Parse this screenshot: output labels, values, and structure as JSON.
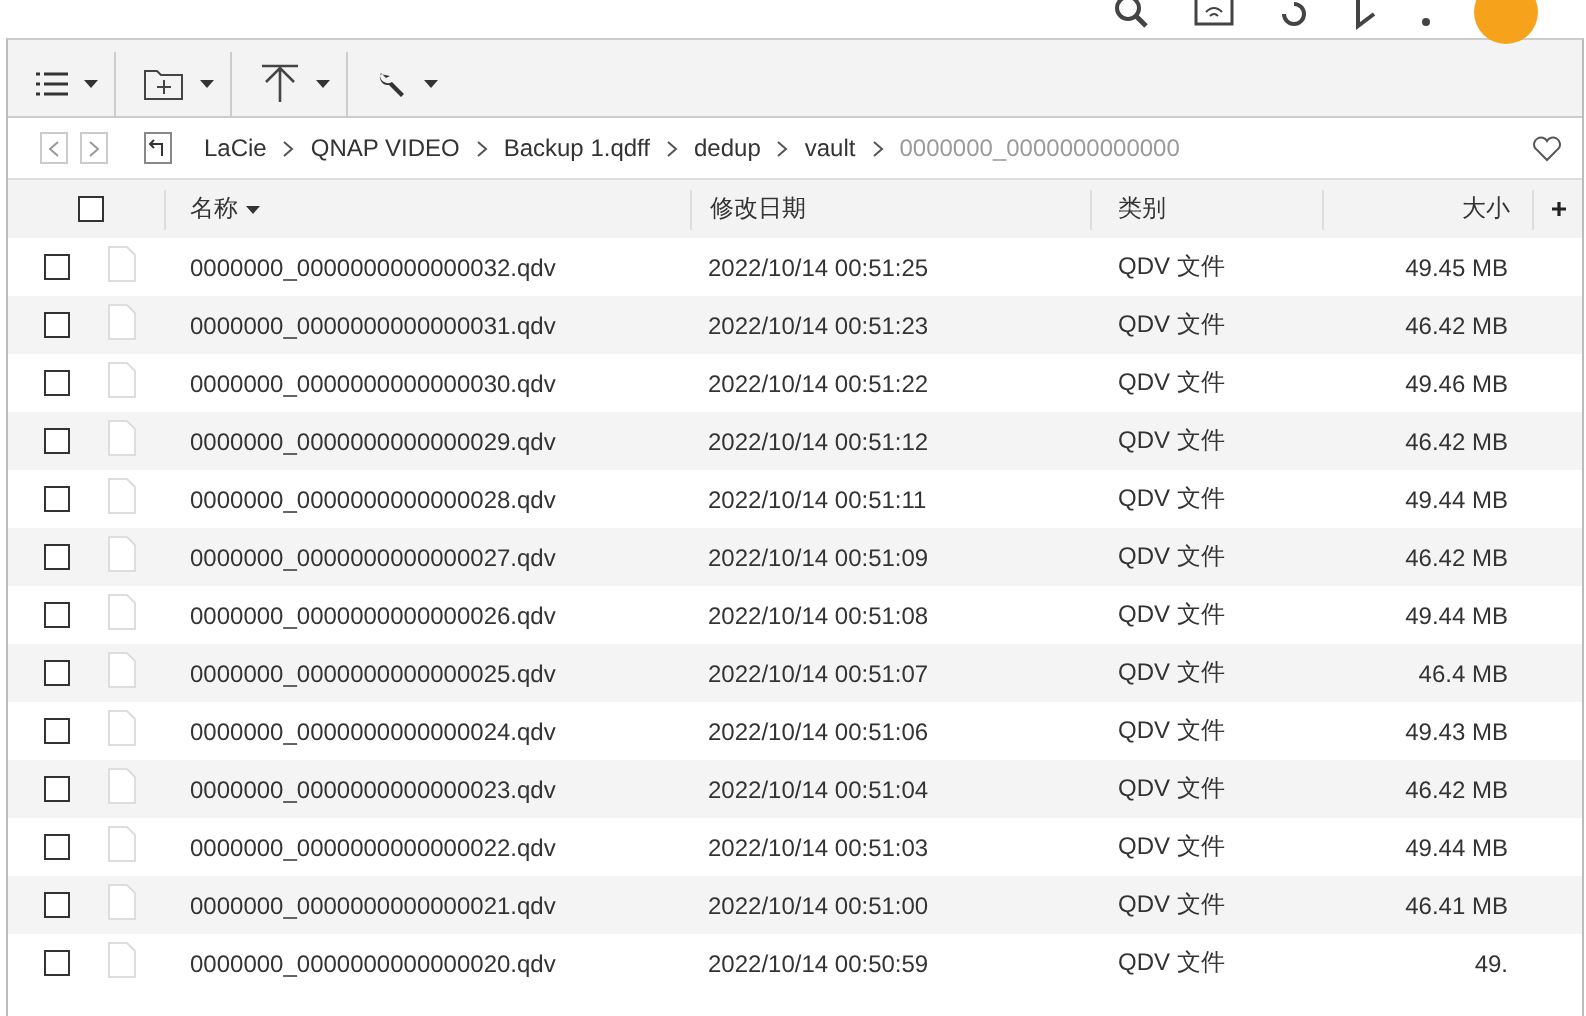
{
  "breadcrumb": [
    {
      "label": "LaCie",
      "current": false
    },
    {
      "label": "QNAP VIDEO",
      "current": false
    },
    {
      "label": "Backup 1.qdff",
      "current": false
    },
    {
      "label": "dedup",
      "current": false
    },
    {
      "label": "vault",
      "current": false
    },
    {
      "label": "0000000_0000000000000",
      "current": true
    }
  ],
  "nav": {
    "back_disabled": true,
    "forward_disabled": true
  },
  "table": {
    "select_all_checked": false,
    "columns": [
      "名称",
      "修改日期",
      "类别",
      "大小"
    ],
    "rows": [
      {
        "name": "0000000_0000000000000032.qdv",
        "modified": "2022/10/14 00:51:25",
        "type": "QDV 文件",
        "size": "49.45 MB",
        "checked": false
      },
      {
        "name": "0000000_0000000000000031.qdv",
        "modified": "2022/10/14 00:51:23",
        "type": "QDV 文件",
        "size": "46.42 MB",
        "checked": false
      },
      {
        "name": "0000000_0000000000000030.qdv",
        "modified": "2022/10/14 00:51:22",
        "type": "QDV 文件",
        "size": "49.46 MB",
        "checked": false
      },
      {
        "name": "0000000_0000000000000029.qdv",
        "modified": "2022/10/14 00:51:12",
        "type": "QDV 文件",
        "size": "46.42 MB",
        "checked": false
      },
      {
        "name": "0000000_0000000000000028.qdv",
        "modified": "2022/10/14 00:51:11",
        "type": "QDV 文件",
        "size": "49.44 MB",
        "checked": false
      },
      {
        "name": "0000000_0000000000000027.qdv",
        "modified": "2022/10/14 00:51:09",
        "type": "QDV 文件",
        "size": "46.42 MB",
        "checked": false
      },
      {
        "name": "0000000_0000000000000026.qdv",
        "modified": "2022/10/14 00:51:08",
        "type": "QDV 文件",
        "size": "49.44 MB",
        "checked": false
      },
      {
        "name": "0000000_0000000000000025.qdv",
        "modified": "2022/10/14 00:51:07",
        "type": "QDV 文件",
        "size": "46.4 MB",
        "checked": false
      },
      {
        "name": "0000000_0000000000000024.qdv",
        "modified": "2022/10/14 00:51:06",
        "type": "QDV 文件",
        "size": "49.43 MB",
        "checked": false
      },
      {
        "name": "0000000_0000000000000023.qdv",
        "modified": "2022/10/14 00:51:04",
        "type": "QDV 文件",
        "size": "46.42 MB",
        "checked": false
      },
      {
        "name": "0000000_0000000000000022.qdv",
        "modified": "2022/10/14 00:51:03",
        "type": "QDV 文件",
        "size": "49.44 MB",
        "checked": false
      },
      {
        "name": "0000000_0000000000000021.qdv",
        "modified": "2022/10/14 00:51:00",
        "type": "QDV 文件",
        "size": "46.41 MB",
        "checked": false
      },
      {
        "name": "0000000_0000000000000020.qdv",
        "modified": "2022/10/14 00:50:59",
        "type": "QDV 文件",
        "size": "49.",
        "checked": false
      }
    ]
  }
}
